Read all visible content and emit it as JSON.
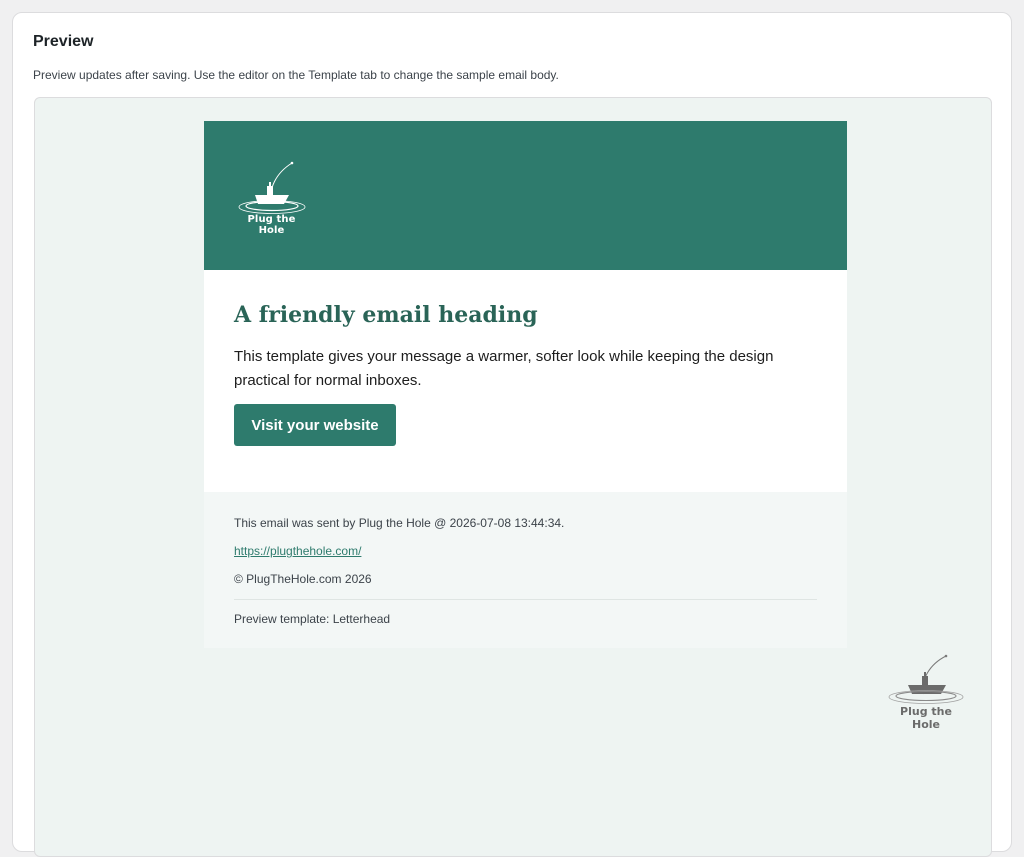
{
  "panel": {
    "title": "Preview",
    "description": "Preview updates after saving. Use the editor on the Template tab to change the sample email body."
  },
  "email": {
    "header": {
      "background": "#2e7b6d",
      "logo_text": "Plug the Hole",
      "logo_icon": "boat-icon"
    },
    "heading": "A friendly email heading",
    "body_text": "This template gives your message a warmer, softer look while keeping the design practical for normal inboxes.",
    "cta_label": "Visit your website",
    "footer": {
      "sent_by": "This email was sent by Plug the Hole @ 2026-07-08 13:44:34.",
      "link": "https://plugthehole.com/",
      "copyright": "© PlugTheHole.com 2026",
      "template_note": "Preview template: Letterhead"
    }
  },
  "corner_logo": {
    "text": "Plug the Hole",
    "icon": "boat-icon"
  },
  "colors": {
    "accent": "#2e7b6d",
    "heading": "#2a6457",
    "preview_background": "#eef4f2"
  }
}
